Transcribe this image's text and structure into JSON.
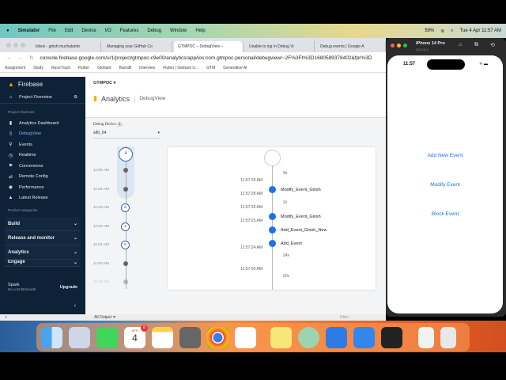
{
  "menubar": {
    "app": "Simulator",
    "items": [
      "File",
      "Edit",
      "Device",
      "I/O",
      "Features",
      "Debug",
      "Window",
      "Help"
    ],
    "battery": "59%",
    "datetime": "Tue 4 Apr 11:57 AM"
  },
  "browser": {
    "tabs": [
      "Inbox - girish.muchalamb",
      "Managing your GitHub Co",
      "GTMPOC – DebugView –",
      "Unable to log in Debug Vi",
      "Debug events | Google A"
    ],
    "url": "console.firebase.google.com/u/1/project/gtmpoc-c9e00/analytics/app/ios:com.gtmpoc.personal/debugview/~2F%3Ft%3D1680589378402&fpr%3D5478",
    "bookmarks": [
      "Assignment",
      "Study",
      "RaceTrack",
      "Flutter",
      "Globant",
      "BarraB",
      "Interview",
      "Flutter | Globant U...",
      "GTM",
      "Generative AI"
    ]
  },
  "sidebar": {
    "brand": "Firebase",
    "project_overview": "Project Overview",
    "shortcuts_label": "Project shortcuts",
    "items": [
      {
        "label": "Analytics Dashboard",
        "icon": "bar-chart-icon"
      },
      {
        "label": "DebugView",
        "icon": "debug-icon"
      },
      {
        "label": "Events",
        "icon": "events-icon"
      },
      {
        "label": "Realtime",
        "icon": "clock-icon"
      },
      {
        "label": "Conversions",
        "icon": "flag-icon"
      },
      {
        "label": "Remote Config",
        "icon": "remote-config-icon"
      },
      {
        "label": "Performance",
        "icon": "performance-icon"
      },
      {
        "label": "Latest Release",
        "icon": "release-icon"
      }
    ],
    "categories_label": "Product categories",
    "categories": [
      "Build",
      "Release and monitor",
      "Analytics",
      "Engage"
    ],
    "plan": "Spark",
    "plan_sub": "No cost $0/month",
    "upgrade": "Upgrade"
  },
  "main": {
    "project": "GTMPOC",
    "product": "Analytics",
    "page": "DebugView",
    "device_label": "Debug Device",
    "device_count": "2",
    "device": "x86_64",
    "minutes": [
      {
        "time": "11:55 AM",
        "type": "dot"
      },
      {
        "time": "11:54 AM",
        "type": "dot"
      },
      {
        "time": "11:53 AM",
        "type": "circle",
        "count": "6"
      },
      {
        "time": "11:52 AM",
        "type": "circle",
        "count": "4"
      },
      {
        "time": "11:51 AM",
        "type": "circle",
        "count": "6"
      },
      {
        "time": "11:50 AM",
        "type": "dot"
      },
      {
        "time": "11:49 AM",
        "type": "dot"
      }
    ],
    "current_count": "4",
    "timestamps": [
      "11:57:29 AM",
      "11:57:28 AM",
      "11:57:26 AM",
      "11:57:25 AM",
      "11:57:24 AM",
      "11:57:00 AM"
    ],
    "events": [
      "Modify_Event_Girish",
      "Modify_Event_Girish",
      "Add_Event_Girish_New",
      "Add_Event"
    ],
    "gaps": [
      "8s",
      "2s",
      "24s",
      "60s"
    ]
  },
  "bottom": {
    "output": "All Output ≑",
    "filter": "Filter"
  },
  "simulator": {
    "device": "iPhone 14 Pro",
    "os": "iOS 16.2",
    "time": "11:57",
    "buttons": [
      "Add New Event",
      "Modify Event",
      "Block Event"
    ]
  },
  "dock": {
    "calendar_month": "APR",
    "calendar_day": "4",
    "badge": "8"
  }
}
